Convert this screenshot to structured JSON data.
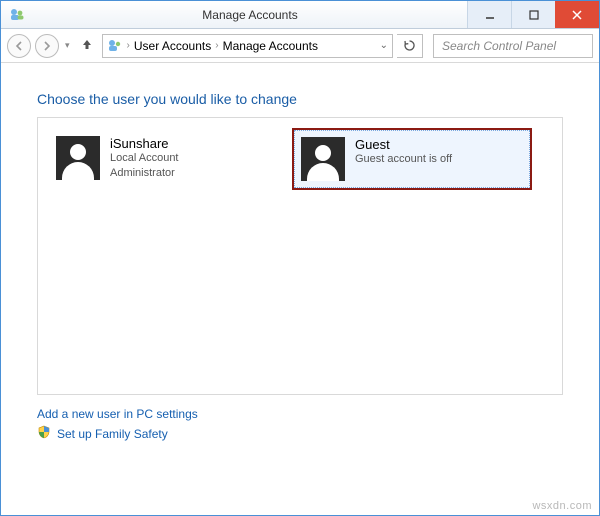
{
  "window": {
    "title": "Manage Accounts"
  },
  "nav": {
    "seg1": "User Accounts",
    "seg2": "Manage Accounts",
    "search_placeholder": "Search Control Panel"
  },
  "content": {
    "heading": "Choose the user you would like to change",
    "accounts": [
      {
        "name": "iSunshare",
        "line1": "Local Account",
        "line2": "Administrator",
        "selected": false
      },
      {
        "name": "Guest",
        "line1": "Guest account is off",
        "line2": "",
        "selected": true
      }
    ],
    "links": {
      "add_user": "Add a new user in PC settings",
      "family_safety": "Set up Family Safety"
    }
  },
  "watermark": "wsxdn.com"
}
